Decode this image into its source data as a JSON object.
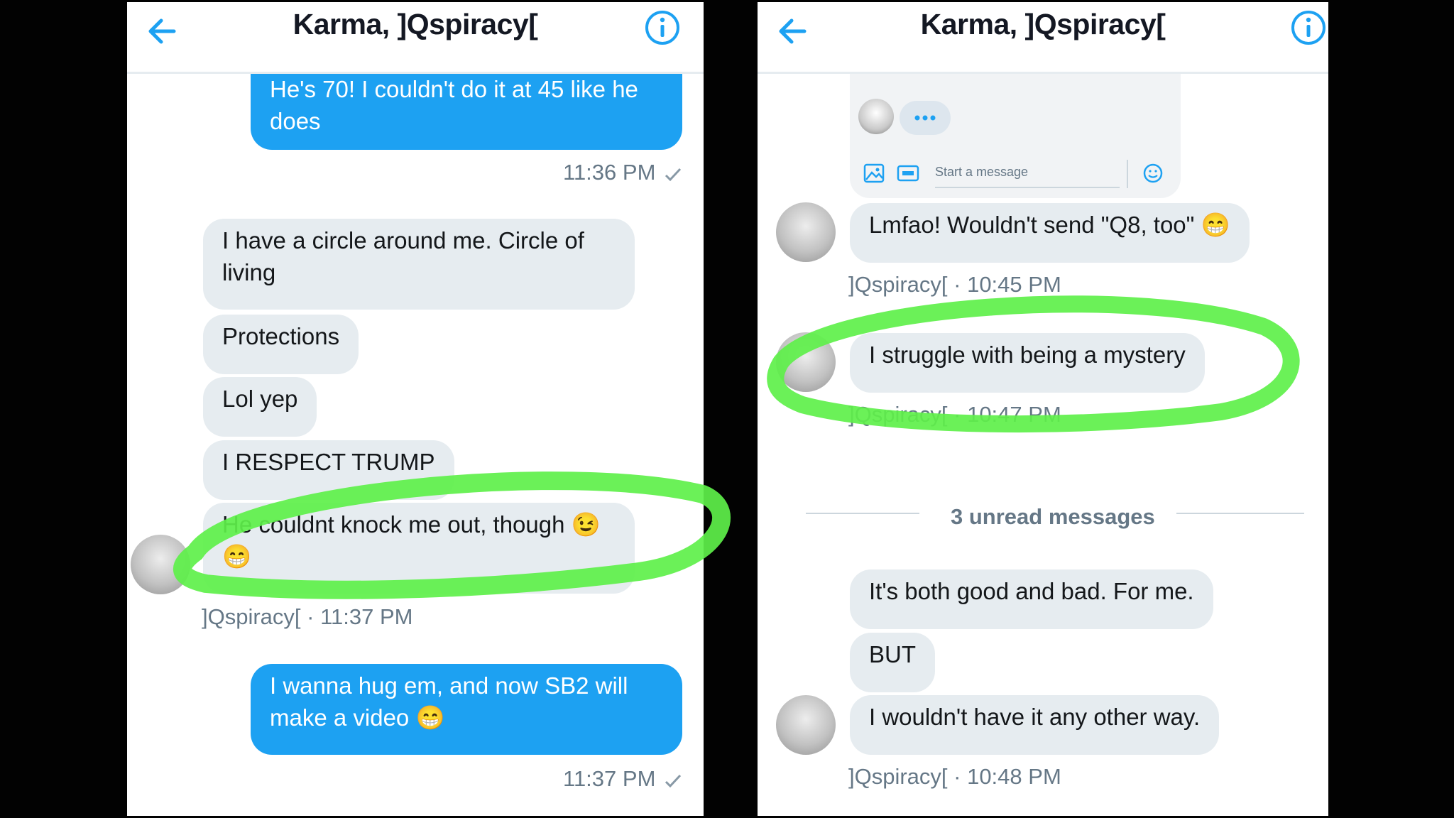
{
  "left_panel": {
    "title": "Karma, ]Qspiracy[",
    "messages": [
      {
        "text": "He's 70! I couldn't do it at 45 like he does"
      },
      {
        "time": "11:36 PM"
      },
      {
        "text": "I have a circle around me. Circle of living"
      },
      {
        "text": "Protections"
      },
      {
        "text": "Lol yep"
      },
      {
        "text": "I RESPECT TRUMP"
      },
      {
        "text": "He couldnt knock me out, though 😉😁"
      },
      {
        "meta": "]Qspiracy[ · 11:37 PM"
      },
      {
        "text": "I wanna hug em, and now SB2 will make a video 😁"
      },
      {
        "time": "11:37 PM"
      }
    ]
  },
  "right_panel": {
    "title": "Karma, ]Qspiracy[",
    "composer_placeholder": "Start a message",
    "messages": [
      {
        "text": "Lmfao! Wouldn't send \"Q8, too\" 😁"
      },
      {
        "meta": "]Qspiracy[ · 10:45 PM"
      },
      {
        "text": "I struggle with being a mystery"
      },
      {
        "meta": "]Qspiracy[ · 10:47 PM"
      },
      {
        "text": "3 unread messages"
      },
      {
        "text": "It's both good and bad. For me."
      },
      {
        "text": "BUT"
      },
      {
        "text": "I wouldn't have it any other way."
      },
      {
        "meta": "]Qspiracy[ · 10:48 PM"
      }
    ]
  },
  "colors": {
    "accent": "#1da1f2",
    "incoming_bubble": "#e6ecf0",
    "highlight": "#5ef04a",
    "backdrop": "#020202"
  },
  "icons": [
    "back-arrow-icon",
    "info-icon",
    "read-check-icon",
    "image-icon",
    "gif-icon",
    "emoji-icon",
    "typing-dots-icon"
  ]
}
